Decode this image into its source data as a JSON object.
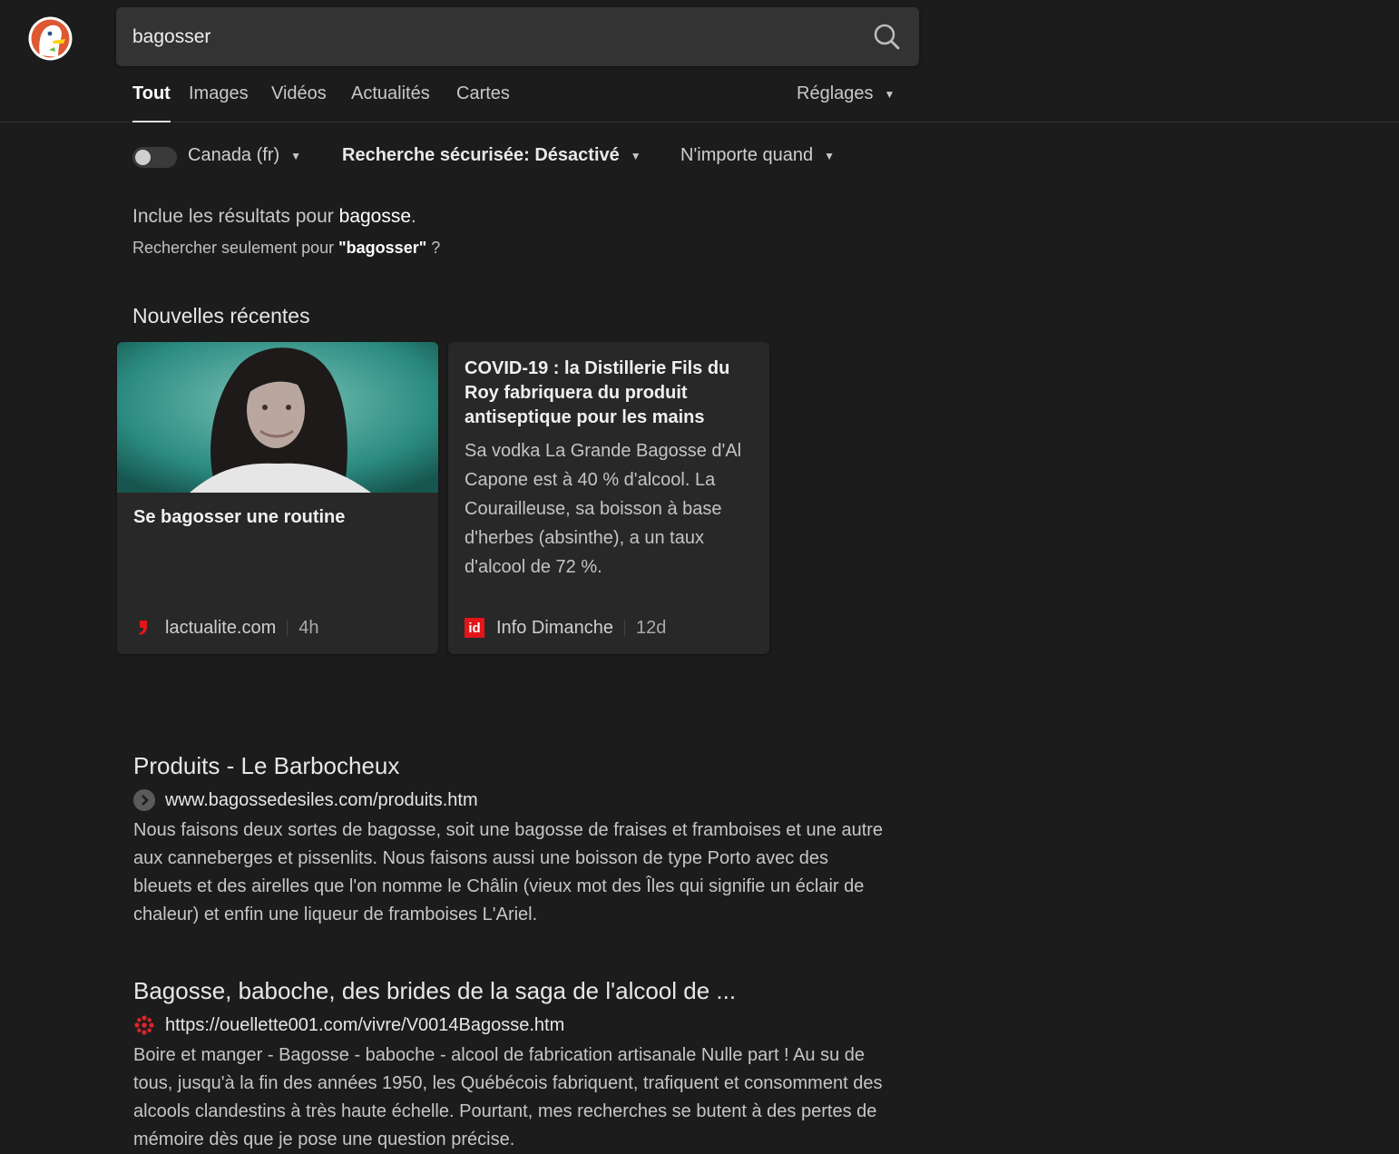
{
  "search": {
    "query": "bagosser",
    "button_icon": "search-icon"
  },
  "tabs": [
    {
      "label": "Tout",
      "active": true
    },
    {
      "label": "Images"
    },
    {
      "label": "Vidéos"
    },
    {
      "label": "Actualités"
    },
    {
      "label": "Cartes"
    }
  ],
  "settings_label": "Réglages",
  "filters": {
    "region": "Canada (fr)",
    "safe_search": "Recherche sécurisée: Désactivé",
    "time": "N'importe quand"
  },
  "spelling": {
    "prefix": "Inclue les résultats pour",
    "corrected": "bagosse",
    "suffix": ".",
    "only_prefix": "Rechercher seulement pour",
    "only_query": "\"bagosser\"",
    "only_suffix": " ?"
  },
  "news": {
    "heading": "Nouvelles récentes",
    "cards": [
      {
        "title": "Se bagosser une routine",
        "source": "lactualite.com",
        "age": "4h",
        "icon": "lactualite-logo-icon"
      },
      {
        "title": "COVID-19 : la Distillerie Fils du Roy fabriquera du produit antiseptique pour les mains",
        "excerpt": "Sa vodka La Grande Bagosse d'Al Capone est à 40 % d'alcool. La Courailleuse, sa boisson à base d'herbes (absinthe), a un taux d'alcool de 72 %.",
        "source": "Info Dimanche",
        "source_badge": "id",
        "age": "12d"
      }
    ]
  },
  "results": [
    {
      "title": "Produits - Le Barbocheux",
      "url": "www.bagossedesiles.com/produits.htm",
      "snippet": "Nous faisons deux sortes de bagosse, soit une bagosse de fraises et framboises et une autre aux canneberges et pissenlits. Nous faisons aussi une boisson de type Porto avec des bleuets et des airelles que l'on nomme le Châlin (vieux mot des Îles qui signifie un éclair de chaleur) et enfin une liqueur de framboises L'Ariel.",
      "icon": "chevron-right-icon"
    },
    {
      "title": "Bagosse, baboche, des brides de la saga de l'alcool de ...",
      "url": "https://ouellette001.com/vivre/V0014Bagosse.htm",
      "snippet": "Boire et manger - Bagosse - baboche - alcool de fabrication artisanale Nulle part ! Au su de tous, jusqu'à la fin des années 1950, les Québécois fabriquent, trafiquent et consomment des alcools clandestins à très haute échelle. Pourtant, mes recherches se butent à des pertes de mémoire dès que je pose une question précise.",
      "icon": "red-dots-favicon-icon"
    }
  ],
  "colors": {
    "background": "#1c1c1c",
    "card": "#282828",
    "search_box": "#333333",
    "accent_red": "#e3151a"
  }
}
